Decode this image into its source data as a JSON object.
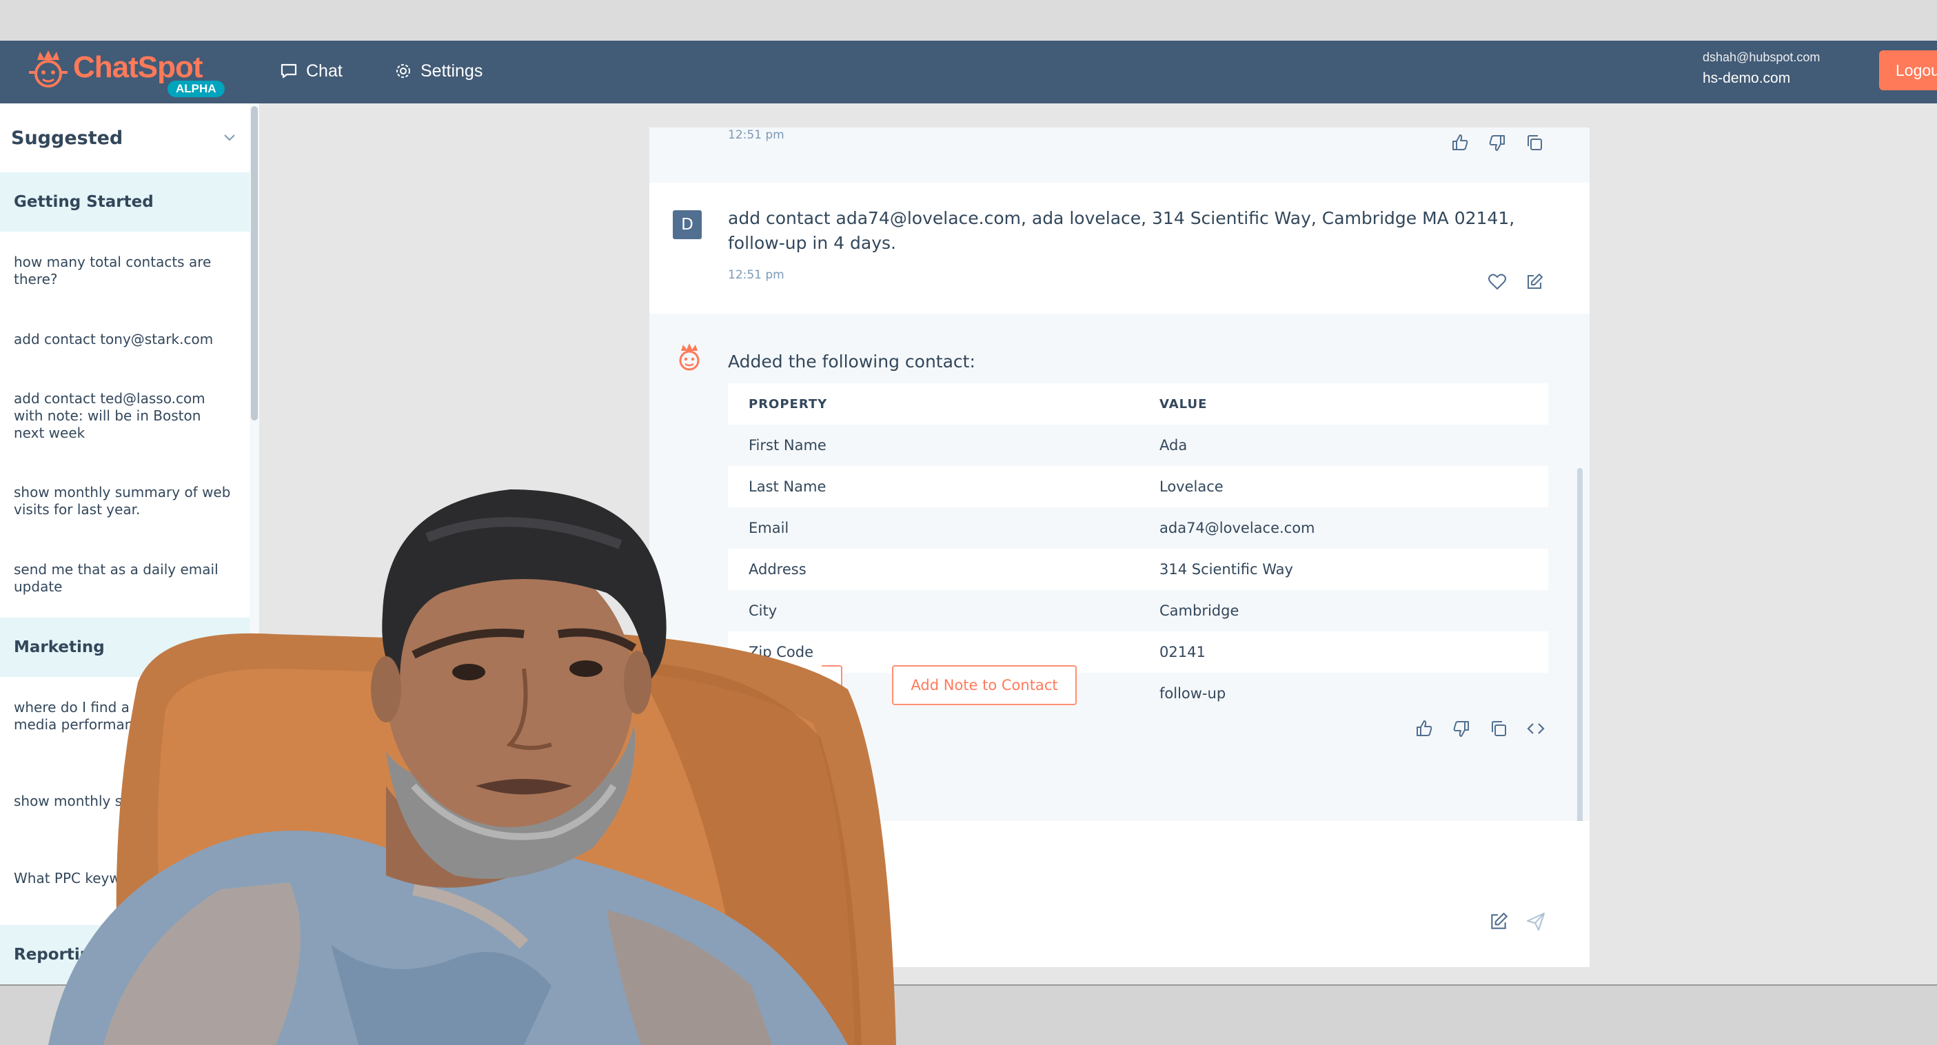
{
  "app": {
    "logo_text": "ChatSpot",
    "logo_badge": "ALPHA"
  },
  "nav": {
    "chat_label": "Chat",
    "settings_label": "Settings",
    "user_email": "dshah@hubspot.com",
    "portal": "hs-demo.com",
    "logout_label": "Logou"
  },
  "sidebar": {
    "title": "Suggested",
    "sections": [
      {
        "label": "Getting Started",
        "items": [
          "how many total contacts are there?",
          "add contact tony@stark.com",
          "add contact ted@lasso.com with note: will be in Boston next week",
          "show monthly summary of web visits for last year.",
          "send me that as a daily email update"
        ]
      },
      {
        "label": "Marketing",
        "items": [
          "where do I find a re my social media performance?",
          "show monthly s web visits for la",
          "What PPC keyw canva.com buy"
        ]
      },
      {
        "label": "Reporting",
        "items": []
      }
    ]
  },
  "chat": {
    "prev_timestamp": "12:51 pm",
    "user_message": {
      "avatar": "D",
      "text": "add contact ada74@lovelace.com, ada lovelace, 314 Scientific Way, Cambridge MA 02141, follow-up in 4 days.",
      "timestamp": "12:51 pm"
    },
    "bot_message": {
      "text": "Added the following contact:",
      "table_headers": [
        "PROPERTY",
        "VALUE"
      ],
      "rows": [
        {
          "property": "First Name",
          "value": "Ada"
        },
        {
          "property": "Last Name",
          "value": "Lovelace"
        },
        {
          "property": "Email",
          "value": "ada74@lovelace.com"
        },
        {
          "property": "Address",
          "value": "314 Scientific Way"
        },
        {
          "property": "City",
          "value": "Cambridge"
        },
        {
          "property": "Zip Code",
          "value": "02141"
        },
        {
          "property": "",
          "value": "follow-up"
        }
      ],
      "add_note_label": "Add Note to Contact"
    }
  },
  "colors": {
    "nav_bg": "#425b76",
    "accent": "#ff7a59",
    "section_bg": "#e5f5f8"
  },
  "icons": [
    "chat-bubble-icon",
    "gear-icon",
    "chevron-down-icon",
    "thumbs-up-icon",
    "thumbs-down-icon",
    "copy-icon",
    "heart-icon",
    "edit-icon",
    "code-icon",
    "send-icon"
  ]
}
